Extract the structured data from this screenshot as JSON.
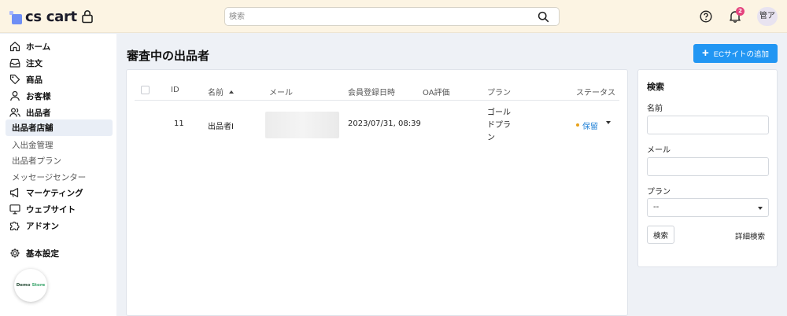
{
  "header": {
    "logo_text": "cs cart",
    "search_placeholder": "検索",
    "notification_count": "2",
    "avatar_text": "管ア"
  },
  "sidebar": {
    "items": [
      {
        "label": "ホーム",
        "icon": "home-icon"
      },
      {
        "label": "注文",
        "icon": "inbox-icon"
      },
      {
        "label": "商品",
        "icon": "tag-icon"
      },
      {
        "label": "お客様",
        "icon": "user-icon"
      },
      {
        "label": "出品者",
        "icon": "users-icon"
      }
    ],
    "sub_items": [
      "出品者店舗",
      "入出金管理",
      "出品者プラン",
      "メッセージセンター"
    ],
    "active_sub_item": "出品者店舗",
    "items_bottom": [
      {
        "label": "マーケティング",
        "icon": "megaphone-icon"
      },
      {
        "label": "ウェブサイト",
        "icon": "monitor-icon"
      },
      {
        "label": "アドオン",
        "icon": "puzzle-icon"
      }
    ],
    "settings_label": "基本設定",
    "demo_store": {
      "demo": "Demo",
      "store": "Store"
    }
  },
  "main": {
    "page_title": "審査中の出品者",
    "add_button_label": "ECサイトの追加",
    "table": {
      "headers": {
        "id": "ID",
        "name": "名前",
        "email": "メール",
        "registered": "会員登録日時",
        "oa_rating": "OA評価",
        "plan": "プラン",
        "status": "ステータス"
      },
      "rows": [
        {
          "id": "11",
          "name": "出品者I",
          "email": "",
          "registered": "2023/07/31, 08:39",
          "oa_rating": "",
          "plan_lines": [
            "ゴール",
            "ドプラ",
            "ン"
          ],
          "status": "保留"
        }
      ]
    }
  },
  "filter": {
    "title": "検索",
    "name_label": "名前",
    "email_label": "メール",
    "plan_label": "プラン",
    "plan_selected": "--",
    "search_button": "検索",
    "advanced_link": "詳細検索"
  },
  "colors": {
    "accent": "#2196f3",
    "header_bg": "#fcf4e3",
    "badge": "#e4437d",
    "status_pending": "#e8a21a"
  }
}
